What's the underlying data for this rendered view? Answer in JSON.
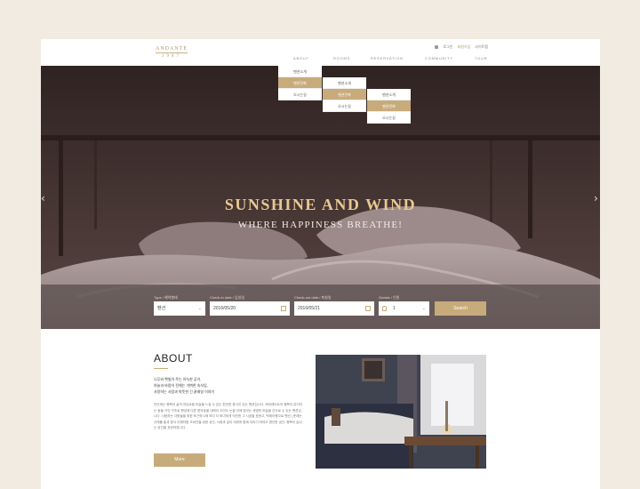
{
  "header": {
    "logo_name": "ANDANTE",
    "logo_year": "1987",
    "util": {
      "login": "로그인",
      "join": "회원가입",
      "sitemap": "사이트맵"
    },
    "nav": [
      "ABOUT",
      "ROOMS",
      "RESERVATION",
      "COMMUNITY",
      "TOUR"
    ]
  },
  "dropdowns": {
    "about": [
      "펜션소개",
      "펜션전화",
      "오시는길"
    ],
    "rooms": [
      "펜션소개",
      "펜션전화",
      "오시는길"
    ],
    "reservation": [
      "펜션소개",
      "펜션전화",
      "오시는길"
    ]
  },
  "hero": {
    "title": "SUNSHINE AND WIND",
    "subtitle": "WHERE HAPPINESS BREATHE!",
    "prev": "‹",
    "next": "›"
  },
  "booking": {
    "type_label": "Type / 예약형태",
    "type_value": "펜션",
    "checkin_label": "Check-in date / 입실일",
    "checkin_value": "2016/05/20",
    "checkout_label": "Check-out date / 퇴실일",
    "checkout_value": "2016/05/21",
    "guests_label": "Guests / 인원",
    "guests_value": "1",
    "search_label": "Search"
  },
  "about": {
    "title": "ABOUT",
    "lead": [
      "나무와 햇빛이 주는 아늑한 공기,",
      "하늘과 바람이 전해는 가벼한 속삭임,",
      "사랑하는 사람과 따뜻한 긴 끝래일 이야기"
    ],
    "body": "안단테는 행복과 삶의 여유로움 미술을 느낄 수 있는 편안한 휴식이 있는 펜션입니다. 께어레이트의 행복이 분어지는 동들 가인 구조로 펜낮에 다른 편의놓을 내레이 오이도 눈쌀 이께 받아는 세명한 하늘을 선사로 수 있는 펜션입니다. 사랑하는 사람들을 위한 포근하시에 보다 더 비녀하게 익관한 그 시공을 표현고, 떡레이행으로 펜션 | 준래는 산애를 통과 형식 이해처험 조비안을 위한 공간, 사랑과 같이 여위와 함께 이야기 하여도 편안한 공간, 행복이 숨쉬는 공간을 표현하였니다.",
    "more_label": "More"
  },
  "colors": {
    "accent": "#c8ab7b",
    "background": "#f1ebe2"
  }
}
